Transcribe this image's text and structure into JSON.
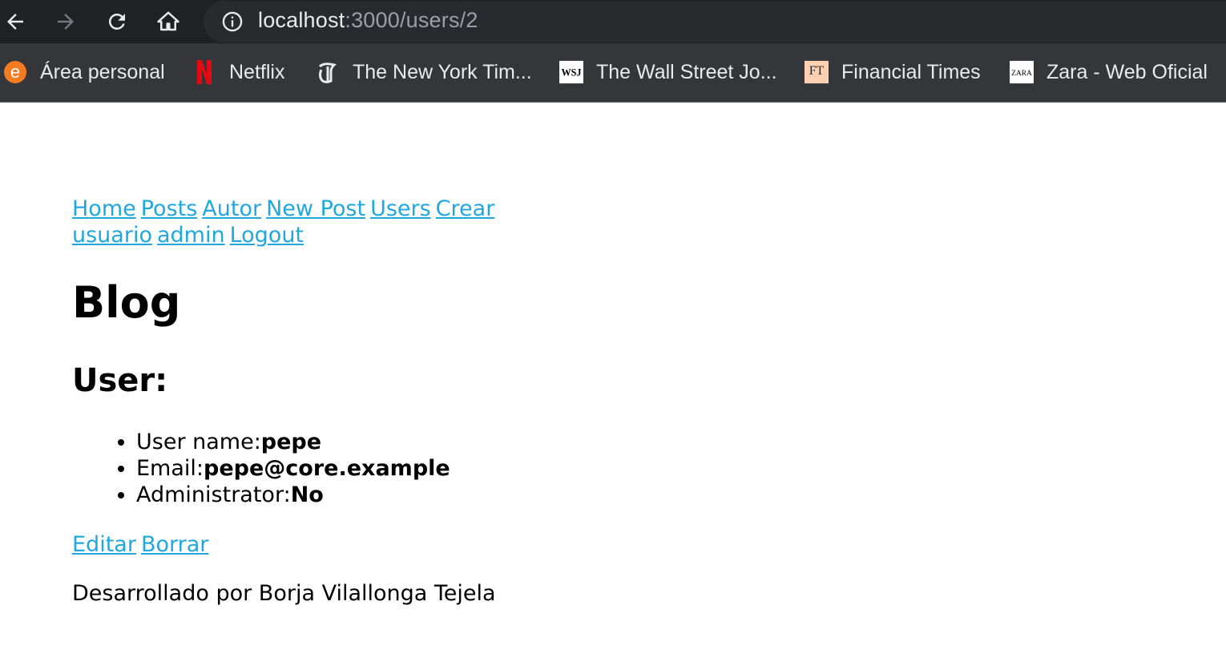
{
  "browser": {
    "url_host": "localhost",
    "url_path": ":3000/users/2",
    "bookmarks": [
      {
        "label": "Área personal",
        "icon": "e-orange-icon"
      },
      {
        "label": "Netflix",
        "icon": "netflix-icon"
      },
      {
        "label": "The New York Tim...",
        "icon": "nyt-icon"
      },
      {
        "label": "The Wall Street Jo...",
        "icon": "wsj-icon"
      },
      {
        "label": "Financial Times",
        "icon": "ft-icon"
      },
      {
        "label": "Zara - Web Oficial",
        "icon": "zara-icon"
      }
    ],
    "icon_text": {
      "e": "e",
      "ft": "FT",
      "wsj": "WSJ",
      "zara": "ZARA"
    }
  },
  "nav": {
    "links": [
      "Home",
      "Posts",
      "Autor",
      "New Post",
      "Users",
      "Crear usuario",
      "admin",
      "Logout"
    ]
  },
  "page": {
    "title": "Blog",
    "subtitle": "User:",
    "details": [
      {
        "label": "User name:",
        "value": "pepe"
      },
      {
        "label": "Email:",
        "value": "pepe@core.example"
      },
      {
        "label": "Administrator:",
        "value": "No"
      }
    ],
    "actions": {
      "edit": "Editar",
      "delete": "Borrar"
    },
    "footer": "Desarrollado por Borja Vilallonga Tejela"
  },
  "colors": {
    "link": "#1fa8e0",
    "chrome_bg": "#202124",
    "bookmarks_bg": "#35363a"
  }
}
